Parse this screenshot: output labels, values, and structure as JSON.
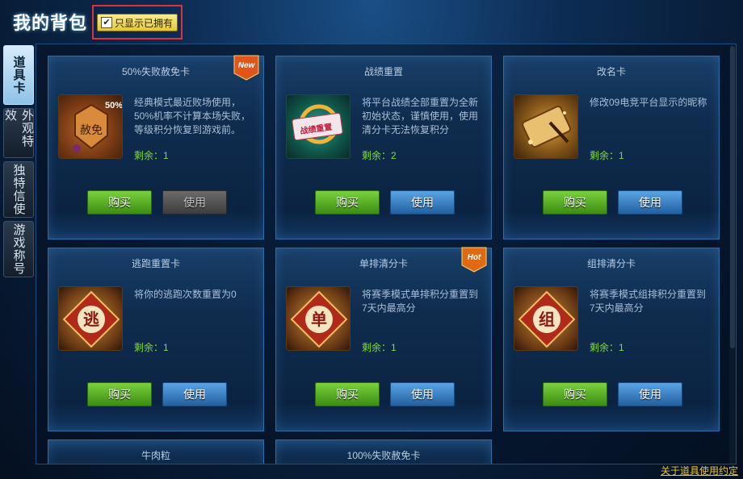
{
  "window": {
    "title": "我的背包",
    "filter_label": "只显示已拥有",
    "filter_checked": "✔"
  },
  "tabs": [
    {
      "label": "道具卡",
      "active": true
    },
    {
      "label": "外观特效",
      "active": false
    },
    {
      "label": "独特信使",
      "active": false
    },
    {
      "label": "游戏称号",
      "active": false
    }
  ],
  "cards": [
    {
      "name": "50%失败赦免卡",
      "desc": "经典模式最近败场使用，50%机率不计算本场失败，等级积分恢复到游戏前。",
      "remain": "剩余：1",
      "buy": "购买",
      "use": "使用",
      "use_disabled": true,
      "badge": "New",
      "img_text": "赦免",
      "img_corner": "50%"
    },
    {
      "name": "战绩重置",
      "desc": "将平台战绩全部重置为全新初始状态，谨慎使用，使用清分卡无法恢复积分",
      "remain": "剩余：2",
      "buy": "购买",
      "use": "使用",
      "use_disabled": false,
      "img_text": "战绩重置"
    },
    {
      "name": "改名卡",
      "desc": "修改09电竞平台显示的昵称",
      "remain": "剩余：1",
      "buy": "购买",
      "use": "使用",
      "use_disabled": false
    },
    {
      "name": "逃跑重置卡",
      "desc": "将你的逃跑次数重置为0",
      "remain": "剩余：1",
      "buy": "购买",
      "use": "使用",
      "use_disabled": false,
      "img_text": "逃"
    },
    {
      "name": "单排清分卡",
      "desc": "将赛季模式单排积分重置到7天内最高分",
      "remain": "剩余：1",
      "buy": "购买",
      "use": "使用",
      "use_disabled": false,
      "badge": "Hot",
      "img_text": "单"
    },
    {
      "name": "组排清分卡",
      "desc": "将赛季模式组排积分重置到7天内最高分",
      "remain": "剩余：1",
      "buy": "购买",
      "use": "使用",
      "use_disabled": false,
      "img_text": "组"
    },
    {
      "name": "牛肉粒"
    },
    {
      "name": "100%失败赦免卡"
    }
  ],
  "footer": {
    "link": "关于道具使用约定"
  },
  "colors": {
    "accent": "#2e6ca6",
    "remain": "#7fe02a",
    "buy": "#4fa51f",
    "use": "#2f77bd",
    "link": "#e5c53a"
  }
}
